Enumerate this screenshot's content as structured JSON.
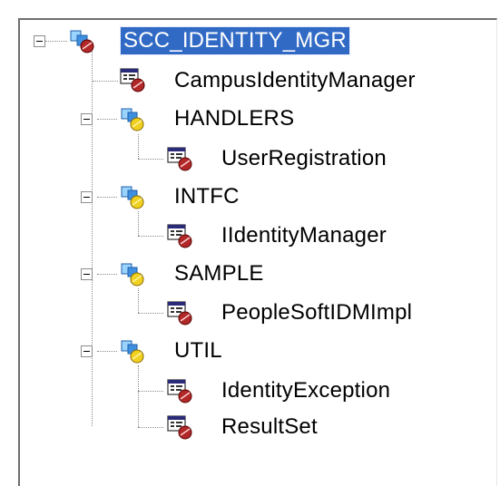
{
  "tree": {
    "root": {
      "label": "SCC_IDENTITY_MGR",
      "icon": "package-cube-icon",
      "selected": true,
      "expanded": true
    },
    "root_class": {
      "label": "CampusIdentityManager",
      "icon": "application-class-icon"
    },
    "packages": [
      {
        "label": "HANDLERS",
        "icon": "subpackage-icon",
        "expanded": true,
        "classes": [
          {
            "label": "UserRegistration",
            "icon": "application-class-icon"
          }
        ]
      },
      {
        "label": "INTFC",
        "icon": "subpackage-icon",
        "expanded": true,
        "classes": [
          {
            "label": "IIdentityManager",
            "icon": "application-class-icon"
          }
        ]
      },
      {
        "label": "SAMPLE",
        "icon": "subpackage-icon",
        "expanded": true,
        "classes": [
          {
            "label": "PeopleSoftIDMImpl",
            "icon": "application-class-icon"
          }
        ]
      },
      {
        "label": "UTIL",
        "icon": "subpackage-icon",
        "expanded": true,
        "classes": [
          {
            "label": "IdentityException",
            "icon": "application-class-icon"
          },
          {
            "label": "ResultSet",
            "icon": "application-class-icon"
          }
        ]
      }
    ]
  },
  "colors": {
    "selection": "#316ac5",
    "tree_lines": "#8a8a8a"
  }
}
